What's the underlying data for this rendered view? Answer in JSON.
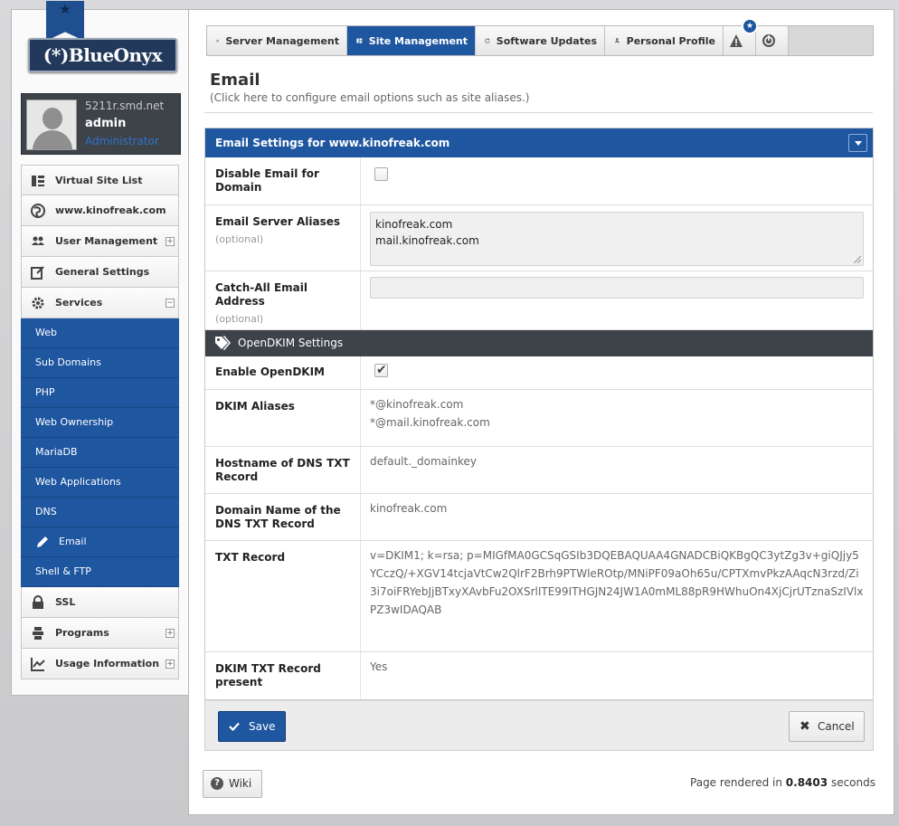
{
  "brand": {
    "logo_text": "(*)BlueOnyx"
  },
  "user": {
    "host": "5211r.smd.net",
    "name": "admin",
    "role": "Administrator"
  },
  "sidebar": {
    "items": [
      {
        "label": "Virtual Site List",
        "icon": "list-icon"
      },
      {
        "label": "www.kinofreak.com",
        "icon": "globe-icon"
      },
      {
        "label": "User Management",
        "icon": "users-icon",
        "expand": "+"
      },
      {
        "label": "General Settings",
        "icon": "edit-icon"
      },
      {
        "label": "Services",
        "icon": "gear-icon",
        "expand": "−"
      }
    ],
    "services_sub": [
      {
        "label": "Web"
      },
      {
        "label": "Sub Domains"
      },
      {
        "label": "PHP"
      },
      {
        "label": "Web Ownership"
      },
      {
        "label": "MariaDB"
      },
      {
        "label": "Web Applications"
      },
      {
        "label": "DNS"
      },
      {
        "label": "Email",
        "active": true
      },
      {
        "label": "Shell & FTP"
      }
    ],
    "items_after": [
      {
        "label": "SSL",
        "icon": "lock-icon"
      },
      {
        "label": "Programs",
        "icon": "programs-icon",
        "expand": "+"
      },
      {
        "label": "Usage Information",
        "icon": "chart-icon",
        "expand": "+"
      }
    ]
  },
  "topnav": {
    "tabs": [
      {
        "label": "Server Management"
      },
      {
        "label": "Site Management",
        "active": true
      },
      {
        "label": "Software Updates"
      },
      {
        "label": "Personal Profile"
      }
    ]
  },
  "page": {
    "title": "Email",
    "subtitle": "(Click here to configure email options such as site aliases.)"
  },
  "form": {
    "header": "Email Settings for www.kinofreak.com",
    "disable_email_label": "Disable Email for Domain",
    "server_aliases_label": "Email Server Aliases",
    "optional_text": "(optional)",
    "server_aliases_value_1": "kinofreak.com",
    "server_aliases_value_2": "mail.kinofreak.com",
    "catch_all_label": "Catch-All Email Address",
    "catch_all_value": "",
    "dkim_section": "OpenDKIM Settings",
    "enable_dkim_label": "Enable OpenDKIM",
    "dkim_aliases_label": "DKIM Aliases",
    "dkim_alias_1": "*@kinofreak.com",
    "dkim_alias_2": "*@mail.kinofreak.com",
    "dns_hostname_label": "Hostname of DNS TXT Record",
    "dns_hostname_value": "default._domainkey",
    "dns_domain_label": "Domain Name of the DNS TXT Record",
    "dns_domain_value": "kinofreak.com",
    "txt_record_label": "TXT Record",
    "txt_record_value": "v=DKIM1; k=rsa; p=MIGfMA0GCSqGSIb3DQEBAQUAA4GNADCBiQKBgQC3ytZg3v+giQJjy5YCczQ/+XGV14tcjaVtCw2QlrF2Brh9PTWleROtp/MNiPF09aOh65u/CPTXmvPkzAAqcN3rzd/Zi3i7oiFRYebJjBTxyXAvbFu2OXSrlITE99ITHGJN24JW1A0mML88pR9HWhuOn4XjCjrUTznaSzIVlxPZ3wIDAQAB",
    "dkim_present_label": "DKIM TXT Record present",
    "dkim_present_value": "Yes"
  },
  "actions": {
    "save_label": "Save",
    "cancel_label": "Cancel"
  },
  "footer": {
    "wiki_label": "Wiki",
    "render_prefix": "Page rendered in",
    "render_time": "0.8403",
    "render_suffix": "seconds"
  },
  "colors": {
    "accent": "#1e56a0",
    "dark_bar": "#3d4349"
  }
}
